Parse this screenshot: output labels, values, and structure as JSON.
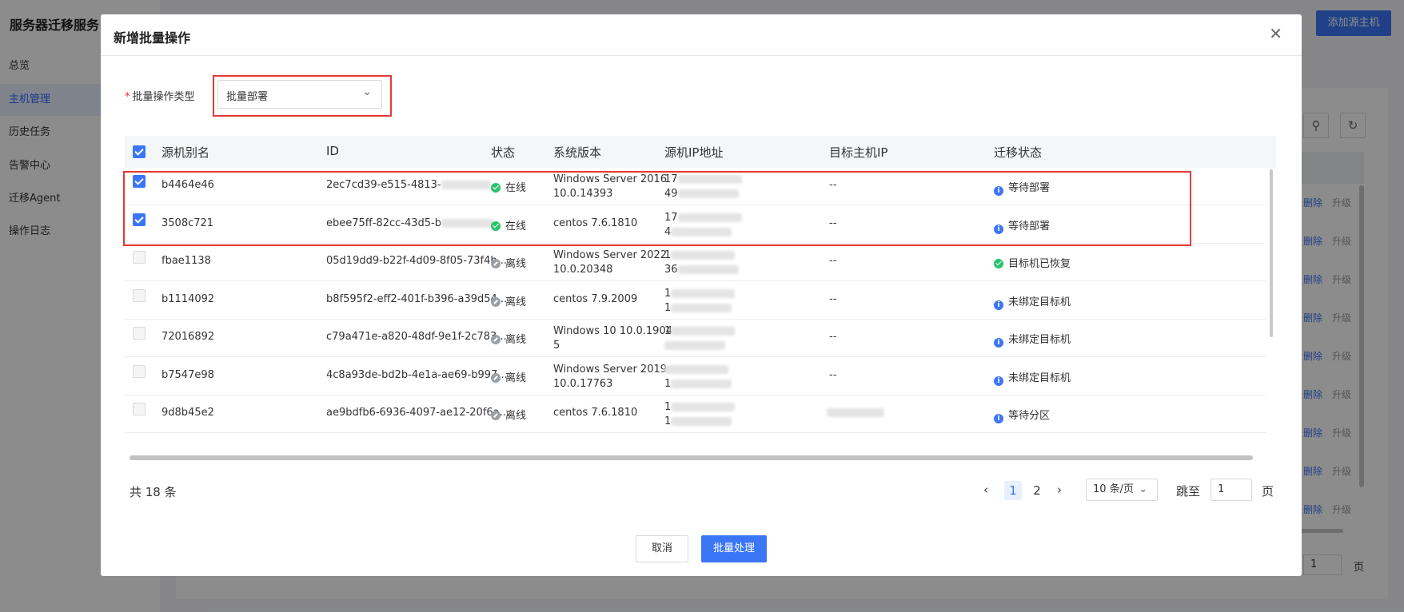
{
  "app": {
    "brand": "服务器迁移服务",
    "nav": [
      "总览",
      "主机管理",
      "历史任务",
      "告警中心",
      "迁移Agent",
      "操作日志"
    ],
    "active_nav": "主机管理",
    "add_host_button": "添加源主机",
    "row_actions": {
      "delete": "删除",
      "upgrade": "升级"
    },
    "jump_value": "1",
    "jump_suffix": "页"
  },
  "modal": {
    "title": "新增批量操作",
    "close_icon": "close-icon",
    "form": {
      "label": "批量操作类型",
      "required_mark": "*",
      "selected": "批量部署"
    },
    "table": {
      "headers": [
        "源机别名",
        "ID",
        "状态",
        "系统版本",
        "源机IP地址",
        "目标主机IP",
        "迁移状态"
      ],
      "rows": [
        {
          "checked": true,
          "alias": "b4464e46",
          "id": "2ec7cd39-e515-4813-",
          "id_suffix": "...",
          "status": "在线",
          "status_type": "online",
          "os": [
            "Windows Server 2016",
            "10.0.14393"
          ],
          "ip_lines": [
            "17",
            "49"
          ],
          "target_ip": "--",
          "migration": "等待部署",
          "migration_type": "info"
        },
        {
          "checked": true,
          "alias": "3508c721",
          "id": "ebee75ff-82cc-43d5-b",
          "id_suffix": "",
          "status": "在线",
          "status_type": "online",
          "os": [
            "centos 7.6.1810"
          ],
          "ip_lines": [
            "17",
            "4"
          ],
          "target_ip": "--",
          "migration": "等待部署",
          "migration_type": "info"
        },
        {
          "checked": false,
          "alias": "fbae1138",
          "id": "05d19dd9-b22f-4d09-8f05-73f4b...",
          "id_suffix": "",
          "status": "离线",
          "status_type": "offline",
          "os": [
            "Windows Server 2022",
            "10.0.20348"
          ],
          "ip_lines": [
            "1",
            "36"
          ],
          "target_ip": "--",
          "migration": "目标机已恢复",
          "migration_type": "success"
        },
        {
          "checked": false,
          "alias": "b1114092",
          "id": "b8f595f2-eff2-401f-b396-a39d54...",
          "id_suffix": "",
          "status": "离线",
          "status_type": "offline",
          "os": [
            "centos 7.9.2009"
          ],
          "ip_lines": [
            "1",
            "1"
          ],
          "target_ip": "--",
          "migration": "未绑定目标机",
          "migration_type": "info"
        },
        {
          "checked": false,
          "alias": "72016892",
          "id": "c79a471e-a820-48df-9e1f-2c783...",
          "id_suffix": "",
          "status": "离线",
          "status_type": "offline",
          "os": [
            "Windows 10 10.0.1904",
            "5"
          ],
          "ip_lines": [
            "1",
            ""
          ],
          "target_ip": "--",
          "migration": "未绑定目标机",
          "migration_type": "info"
        },
        {
          "checked": false,
          "alias": "b7547e98",
          "id": "4c8a93de-bd2b-4e1a-ae69-b997...",
          "id_suffix": "",
          "status": "离线",
          "status_type": "offline",
          "os": [
            "Windows Server 2019",
            "10.0.17763"
          ],
          "ip_lines": [
            "",
            "1"
          ],
          "target_ip": "--",
          "migration": "未绑定目标机",
          "migration_type": "info"
        },
        {
          "checked": false,
          "alias": "9d8b45e2",
          "id": "ae9bdfb6-6936-4097-ae12-20f6a...",
          "id_suffix": "",
          "status": "离线",
          "status_type": "offline",
          "os": [
            "centos 7.6.1810"
          ],
          "ip_lines": [
            "1",
            "1"
          ],
          "target_ip": "",
          "migration": "等待分区",
          "migration_type": "info"
        }
      ]
    },
    "pagination": {
      "total": "共 18 条",
      "pages": [
        "1",
        "2"
      ],
      "current": "1",
      "page_size": "10 条/页",
      "jump_label": "跳至",
      "jump_value": "1",
      "page_suffix": "页"
    },
    "buttons": {
      "cancel": "取消",
      "submit": "批量处理"
    }
  },
  "colors": {
    "primary": "#3b76f6",
    "highlight": "#e53935",
    "online": "#2bc26b",
    "offline": "#9aa0a6"
  }
}
